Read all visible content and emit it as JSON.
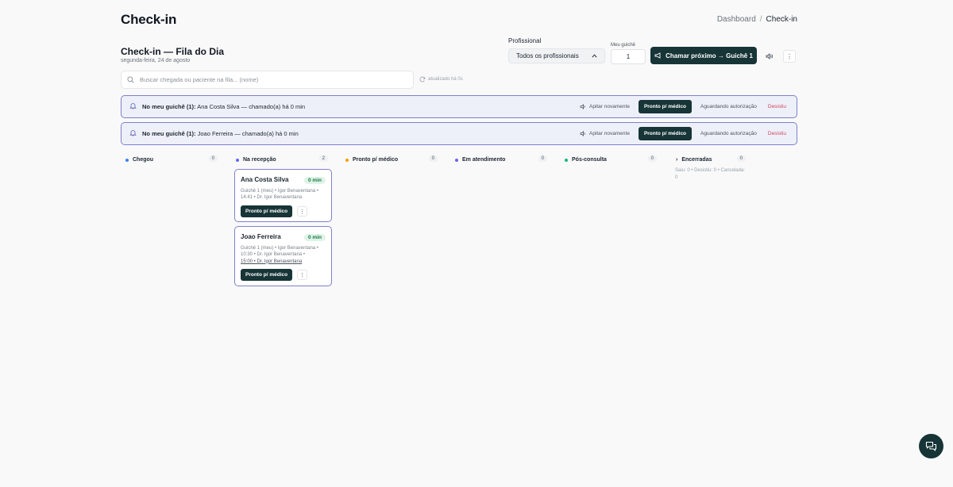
{
  "header": {
    "title": "Check-in",
    "breadcrumb": {
      "dashboard": "Dashboard",
      "separator": "/",
      "current": "Check-in"
    }
  },
  "queue": {
    "title": "Check-in — Fila do Dia",
    "date": "segunda-feira, 24 de agosto"
  },
  "controls": {
    "professional_label": "Profissional",
    "professional_value": "Todos os profissionais",
    "guiche_label": "Meu guichê",
    "guiche_value": "1",
    "call_next_label": "Chamar próximo → Guichê 1",
    "sound_icon": "speaker-icon",
    "more_icon": "more-vertical-icon"
  },
  "search": {
    "placeholder": "Buscar chegada ou paciente na fila... (nome)",
    "updated": "atualizado há 0s"
  },
  "banners": [
    {
      "prefix": "No meu guichê (1):",
      "text": "Ana Costa Silva — chamado(a) há 0 min",
      "beep": "Apitar novamente",
      "ready": "Pronto p/ médico",
      "auth": "Aguardando autorização",
      "gave_up": "Desistiu"
    },
    {
      "prefix": "No meu guichê (1):",
      "text": "Joao Ferreira — chamado(a) há 0 min",
      "beep": "Apitar novamente",
      "ready": "Pronto p/ médico",
      "auth": "Aguardando autorização",
      "gave_up": "Desistiu"
    }
  ],
  "columns": [
    {
      "label": "Chegou",
      "count": "0",
      "color": "#3b82f6"
    },
    {
      "label": "Na recepção",
      "count": "2",
      "color": "#6366f1"
    },
    {
      "label": "Pronto p/ médico",
      "count": "0",
      "color": "#f59e0b"
    },
    {
      "label": "Em atendimento",
      "count": "0",
      "color": "#6366f1"
    },
    {
      "label": "Pós-consulta",
      "count": "0",
      "color": "#10b981"
    },
    {
      "label": "Encerradas",
      "count": "0"
    }
  ],
  "closed_summary": "Saiu: 0 • Desistiu: 0 • Cancelada: 0",
  "cards": [
    {
      "name": "Ana Costa Silva",
      "time": "0 min",
      "line1": "Guichê 1 (meu) • Igor Benaventana •",
      "line2": "14:41 • Dr. Igor Benaventana",
      "ready": "Pronto p/ médico"
    },
    {
      "name": "Joao Ferreira",
      "time": "0 min",
      "line1": "Guichê 1 (meu) • Igor Benaventana •",
      "line2": "10:30 • Dr. Igor Benaventana •",
      "line3": "15:00 • Dr. Igor Benaventana",
      "ready": "Pronto p/ médico"
    }
  ],
  "colors": {
    "accent": "#173437",
    "banner_border": "#7d80c9",
    "banner_bg": "#eef0f9",
    "danger": "#d3455b"
  }
}
